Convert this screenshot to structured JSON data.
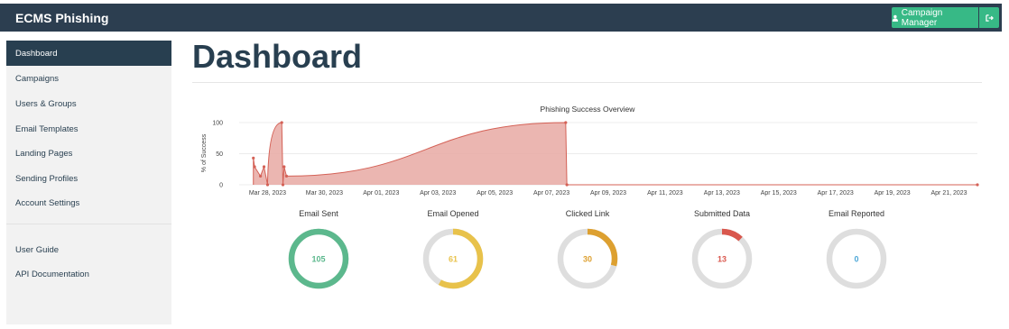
{
  "app": {
    "brand": "ECMS Phishing"
  },
  "header": {
    "user_label": "Campaign Manager",
    "user_icon": "user-icon",
    "logout_icon": "sign-out-icon"
  },
  "sidebar": {
    "items": [
      {
        "label": "Dashboard",
        "active": true
      },
      {
        "label": "Campaigns"
      },
      {
        "label": "Users & Groups"
      },
      {
        "label": "Email Templates"
      },
      {
        "label": "Landing Pages"
      },
      {
        "label": "Sending Profiles"
      },
      {
        "label": "Account Settings"
      }
    ],
    "secondary": [
      {
        "label": "User Guide"
      },
      {
        "label": "API Documentation"
      }
    ]
  },
  "page": {
    "title": "Dashboard"
  },
  "colors": {
    "sent": "#5cb88d",
    "opened": "#e8c24b",
    "clicked": "#dda030",
    "submitted": "#d9574d",
    "reported": "#4da7d7",
    "track": "#dedede",
    "area": "#e8a9a3",
    "line": "#d46156"
  },
  "chart_data": {
    "type": "area",
    "title": "Phishing Success Overview",
    "ylabel": "% of Success",
    "ylim": [
      0,
      100
    ],
    "yticks": [
      0,
      50,
      100
    ],
    "xticks": [
      "Mar 28, 2023",
      "Mar 30, 2023",
      "Apr 01, 2023",
      "Apr 03, 2023",
      "Apr 05, 2023",
      "Apr 07, 2023",
      "Apr 09, 2023",
      "Apr 11, 2023",
      "Apr 13, 2023",
      "Apr 15, 2023",
      "Apr 17, 2023",
      "Apr 19, 2023",
      "Apr 21, 2023"
    ],
    "points": [
      {
        "x": "2023-03-27T12:00",
        "y": 43
      },
      {
        "x": "2023-03-27T13:00",
        "y": 29
      },
      {
        "x": "2023-03-27T18:00",
        "y": 14
      },
      {
        "x": "2023-03-27T21:00",
        "y": 29
      },
      {
        "x": "2023-03-28T00:00",
        "y": 0
      },
      {
        "x": "2023-03-28T12:00",
        "y": 100
      },
      {
        "x": "2023-03-28T13:00",
        "y": 0
      },
      {
        "x": "2023-03-28T14:00",
        "y": 29
      },
      {
        "x": "2023-03-28T16:00",
        "y": 14
      },
      {
        "x": "2023-04-07T12:00",
        "y": 100
      },
      {
        "x": "2023-04-07T13:00",
        "y": 0
      },
      {
        "x": "2023-04-22T00:00",
        "y": 0
      }
    ]
  },
  "stats": [
    {
      "label": "Email Sent",
      "value": "105",
      "fraction": 1.0,
      "color_key": "sent"
    },
    {
      "label": "Email Opened",
      "value": "61",
      "fraction": 0.58,
      "color_key": "opened"
    },
    {
      "label": "Clicked Link",
      "value": "30",
      "fraction": 0.29,
      "color_key": "clicked"
    },
    {
      "label": "Submitted Data",
      "value": "13",
      "fraction": 0.12,
      "color_key": "submitted"
    },
    {
      "label": "Email Reported",
      "value": "0",
      "fraction": 0.0,
      "color_key": "reported"
    }
  ]
}
